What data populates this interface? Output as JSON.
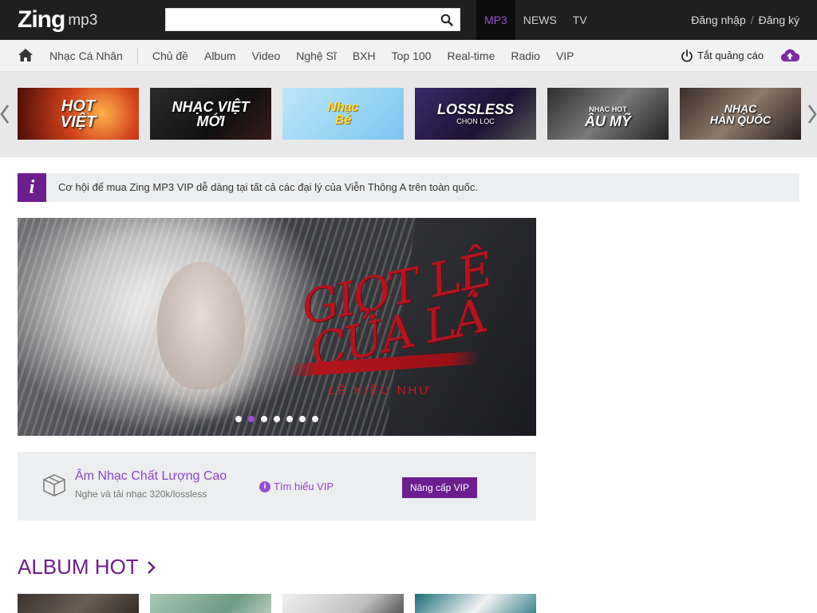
{
  "header": {
    "logo_main": "Zing",
    "logo_sub": "mp3",
    "search": {
      "value": "",
      "placeholder": ""
    },
    "tabs": [
      {
        "label": "MP3",
        "active": true
      },
      {
        "label": "NEWS",
        "active": false
      },
      {
        "label": "TV",
        "active": false
      }
    ],
    "login": "Đăng nhập",
    "separator": "/",
    "register": "Đăng ký"
  },
  "nav": {
    "personal": "Nhạc Cá Nhân",
    "items": [
      "Chủ đề",
      "Album",
      "Video",
      "Nghệ Sĩ",
      "BXH",
      "Top 100",
      "Real-time",
      "Radio",
      "VIP"
    ],
    "ads_off": "Tắt quảng cáo"
  },
  "categories": [
    {
      "name": "hot-viet",
      "lines": [
        "HOT",
        "VIỆT"
      ]
    },
    {
      "name": "nhac-viet-moi",
      "lines": [
        "NHẠC VIỆT",
        "MỚI"
      ]
    },
    {
      "name": "nhac-danh-cho-be",
      "lines": [
        "Nhạc",
        "Bé"
      ]
    },
    {
      "name": "lossless",
      "lines": [
        "LOSSLESS",
        "CHỌN LỌC"
      ]
    },
    {
      "name": "nhac-hot-au-my",
      "lines": [
        "NHẠC HOT",
        "ÂU MỸ"
      ]
    },
    {
      "name": "nhac-han-quoc",
      "lines": [
        "NHẠC",
        "HÀN QUỐC"
      ]
    }
  ],
  "notice": {
    "icon": "i",
    "text": "Cơ hội để mua Zing MP3 VIP dễ dàng tại tất cả các đại lý của Viễn Thông A trên toàn quốc."
  },
  "hero": {
    "title": "Giọt Lệ Của Lá",
    "artist": "LÊ KIỀU NHƯ",
    "slide_count": 7,
    "active_slide": 2
  },
  "vip": {
    "title": "Âm Nhạc Chất Lượng Cao",
    "subtitle": "Nghe và tải nhạc 320k/lossless",
    "learn_more": "Tìm hiểu VIP",
    "upgrade": "Nâng cấp VIP"
  },
  "albums": {
    "heading": "ALBUM HOT"
  },
  "colors": {
    "accent": "#6c1e8f",
    "accent_light": "#9b4ed3",
    "topbar": "#1f1f1f"
  }
}
